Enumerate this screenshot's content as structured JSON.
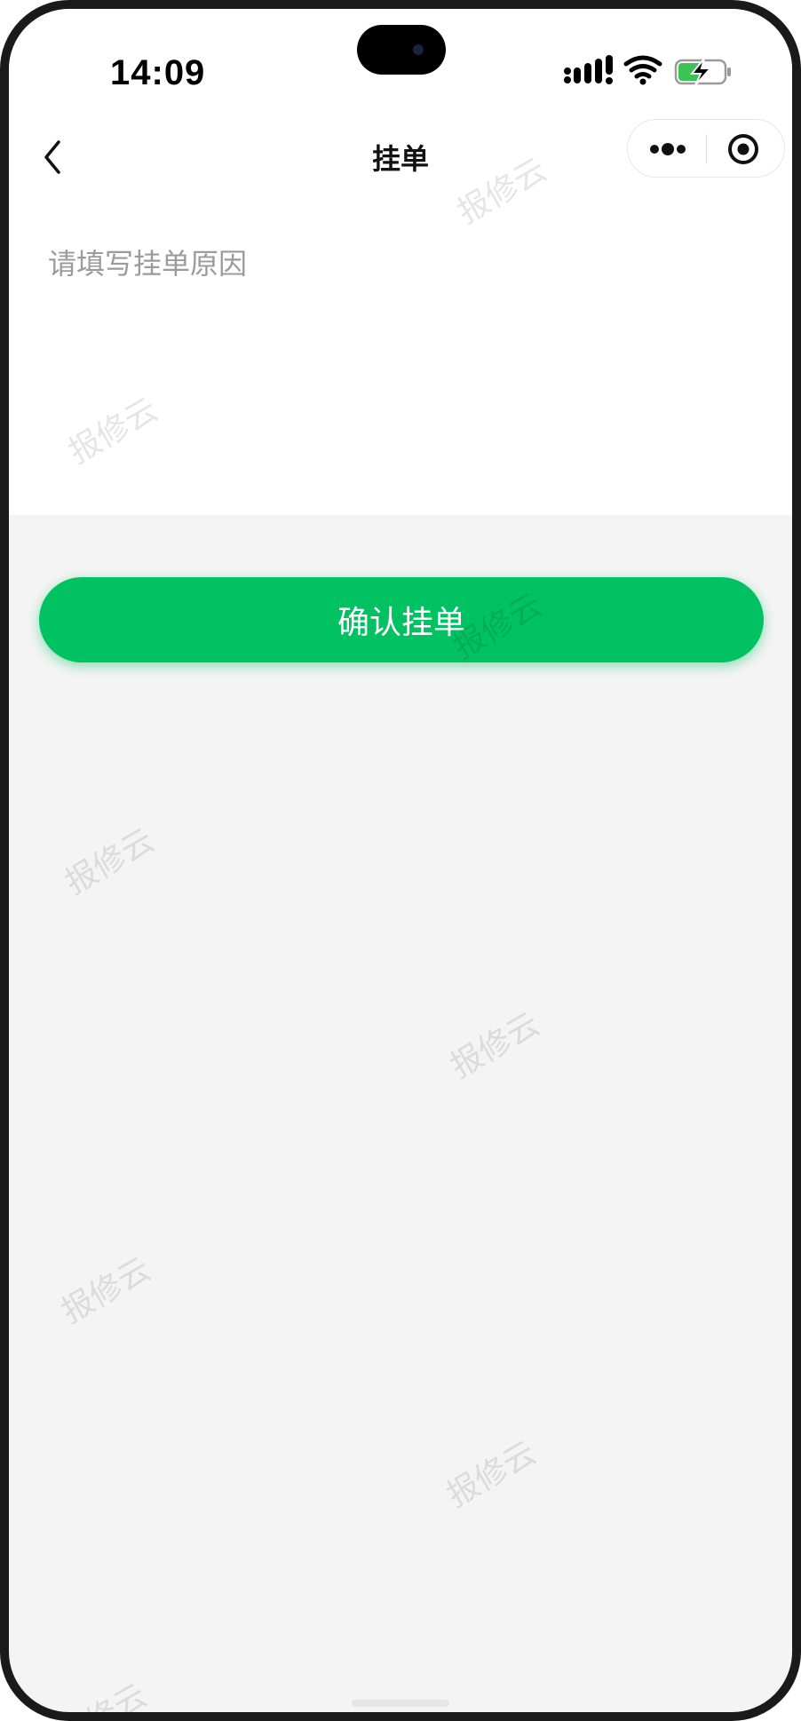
{
  "status_bar": {
    "time": "14:09",
    "icons": [
      "signal-icon",
      "wifi-icon",
      "battery-charging-icon"
    ],
    "battery_color": "#3cc255"
  },
  "nav": {
    "title": "挂单",
    "back_icon": "chevron-left-icon",
    "capsule_icons": [
      "more-icon",
      "target-icon"
    ]
  },
  "form": {
    "reason_placeholder": "请填写挂单原因",
    "reason_value": ""
  },
  "actions": {
    "confirm_label": "确认挂单",
    "accent_color": "#00c262"
  },
  "watermark": {
    "text": "报修云"
  }
}
